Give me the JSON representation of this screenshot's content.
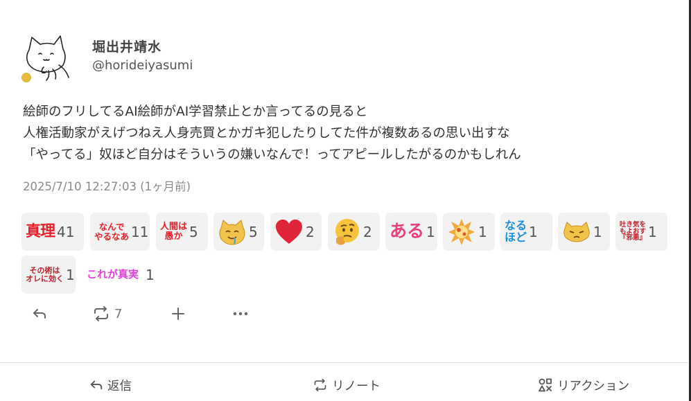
{
  "user": {
    "display_name": "堀出井靖水",
    "handle": "@horideiyasumi",
    "avatar_icon": "cat-sketch-avatar",
    "status_color": "#e4bb3e"
  },
  "post": {
    "lines": [
      "絵師のフリしてるAI絵師がAI学習禁止とか言ってるの見ると",
      "人権活動家がえげつねえ人身売買とかガキ犯したりしてた件が複数あるの思い出すな",
      "「やってる」奴ほど自分はそういうの嫌いなんで！ってアピールしたがるのかもしれん"
    ],
    "timestamp": "2025/7/10 12:27:03 (1ヶ月前)"
  },
  "reactions": [
    {
      "icon": "shinri-text-emoji",
      "text": "真理",
      "count": "41"
    },
    {
      "icon": "nande-yaruna-text-emoji",
      "text_line1": "なんで",
      "text_line2": "やるなあ",
      "count": "11"
    },
    {
      "icon": "ningen-wa-oroka-text-emoji",
      "text_line1": "人間は",
      "text_line2": "愚か",
      "count": "5"
    },
    {
      "icon": "drooling-cat-emoji",
      "count": "5"
    },
    {
      "icon": "red-heart-emoji",
      "count": "2"
    },
    {
      "icon": "thinking-face-emoji",
      "count": "2"
    },
    {
      "icon": "aru-text-emoji",
      "text": "ある",
      "count": "1"
    },
    {
      "icon": "explosion-emoji",
      "count": "1"
    },
    {
      "icon": "naruhodo-text-emoji",
      "text_line1": "なる",
      "text_line2": "ほど",
      "count": "1"
    },
    {
      "icon": "grumpy-cat-emoji",
      "count": "1"
    },
    {
      "icon": "hakike-text-emoji",
      "text_line1": "吐き気を",
      "text_line2": "もよおす",
      "text_line3": "『邪悪』",
      "count": "1"
    },
    {
      "icon": "sono-te-wa-text-emoji",
      "text_line1": "その術は",
      "text_line2": "オレに効く",
      "count": "1"
    },
    {
      "icon": "kore-ga-shinjitsu-text-emoji",
      "text": "これが真実",
      "count": "1"
    }
  ],
  "actions": {
    "reply_icon": "reply-icon",
    "renote_icon": "renote-icon",
    "renote_count": "7",
    "add_icon": "plus-icon",
    "more_icon": "more-icon"
  },
  "footer": {
    "reply_label": "返信",
    "renote_label": "リノート",
    "reaction_label": "リアクション"
  },
  "colors": {
    "accent_red": "#e8202a",
    "aru_pink": "#e7417f",
    "naruhodo_blue": "#1a8fe0",
    "kore_magenta": "#e23fd6"
  }
}
